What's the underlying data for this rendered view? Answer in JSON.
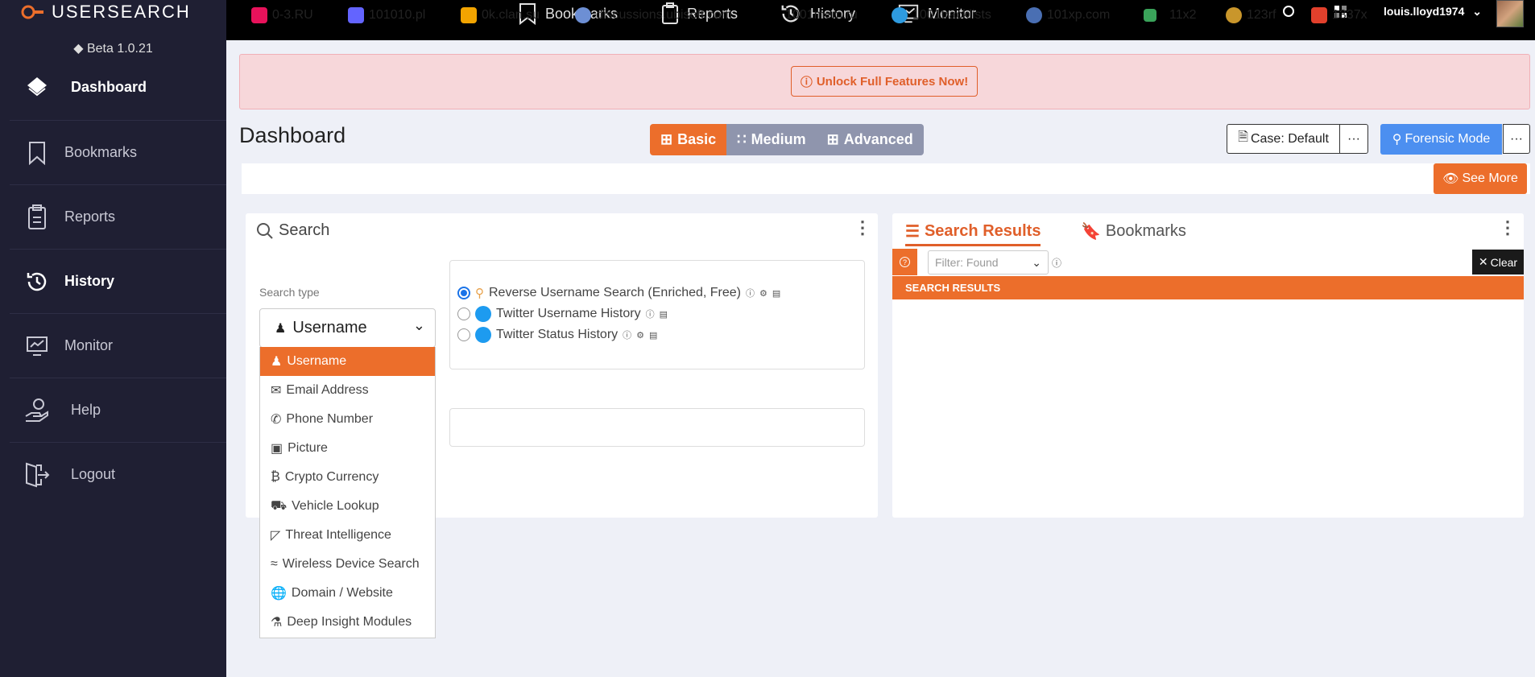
{
  "app": {
    "logo_text": "USERSEARCH",
    "version": "Beta 1.0.21"
  },
  "sidebar": {
    "items": [
      {
        "label": "Dashboard",
        "icon": "layers-icon"
      },
      {
        "label": "Bookmarks",
        "icon": "bookmark-icon"
      },
      {
        "label": "Reports",
        "icon": "clipboard-icon"
      },
      {
        "label": "History",
        "icon": "history-icon"
      },
      {
        "label": "Monitor",
        "icon": "monitor-icon"
      },
      {
        "label": "Help",
        "icon": "help-hand-icon"
      },
      {
        "label": "Logout",
        "icon": "logout-icon"
      }
    ]
  },
  "topnav": {
    "items": [
      "Bookmarks",
      "Reports",
      "History",
      "Monitor"
    ],
    "username": "louis.lloyd1974"
  },
  "banner": {
    "unlock_label": "Unlock Full Features Now!"
  },
  "page": {
    "title": "Dashboard"
  },
  "modes": {
    "basic": "Basic",
    "medium": "Medium",
    "advanced": "Advanced",
    "active": "Basic"
  },
  "case": {
    "label": "Case: Default",
    "more": "···"
  },
  "forensic": {
    "label": "Forensic Mode",
    "more": "···"
  },
  "sites": [
    {
      "name": "0-3.RU",
      "color": "#e8125b"
    },
    {
      "name": "101010.pl",
      "color": "#6364ff"
    },
    {
      "name": "0k.clan.su",
      "color": "#f2a400"
    },
    {
      "name": "discussions.ubisoft.com",
      "color": "#6d8fd4"
    },
    {
      "name": "1001mem.ru",
      "color": "#000000"
    },
    {
      "name": "1001tracklists",
      "color": "#2e9be0"
    },
    {
      "name": "101xp.com",
      "color": "#4a6fb3"
    },
    {
      "name": "11x2",
      "color": "#3aa35a"
    },
    {
      "name": "123rf",
      "color": "#c9962b"
    },
    {
      "name": "1337x",
      "color": "#e2402c"
    }
  ],
  "see_more": "See More",
  "search": {
    "title": "Search",
    "type_label": "Search type",
    "selected_type": "Username",
    "types": [
      "Username",
      "Email Address",
      "Phone Number",
      "Picture",
      "Crypto Currency",
      "Vehicle Lookup",
      "Threat Intelligence",
      "Wireless Device Search",
      "Domain / Website",
      "Deep Insight Modules"
    ],
    "options": [
      {
        "label": "Reverse Username Search (Enriched, Free)",
        "selected": true
      },
      {
        "label": "Twitter Username History",
        "selected": false
      },
      {
        "label": "Twitter Status History",
        "selected": false
      }
    ]
  },
  "results": {
    "tab_results": "Search Results",
    "tab_bookmarks": "Bookmarks",
    "filter_placeholder": "Filter: Found",
    "clear_label": "Clear",
    "header": "SEARCH RESULTS"
  },
  "colors": {
    "accent": "#ec6e2b",
    "sidebar": "#1f1f33",
    "primary": "#4c8ff0"
  }
}
